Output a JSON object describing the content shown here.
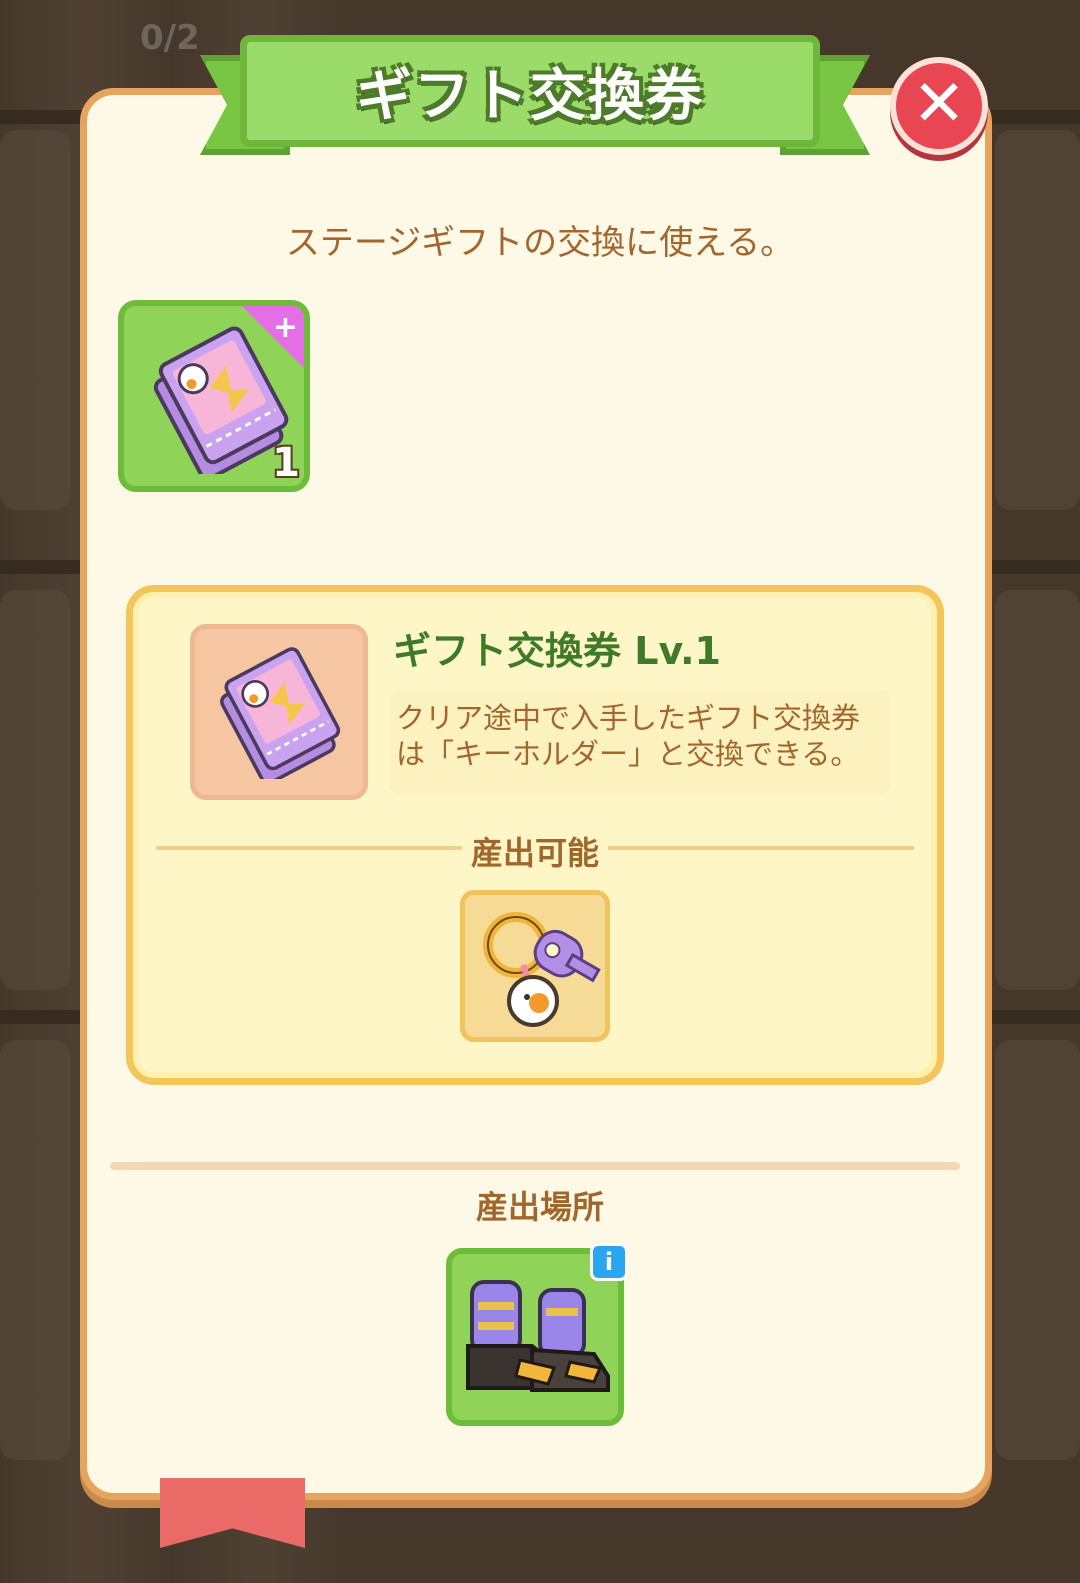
{
  "background": {
    "counter": "0/2"
  },
  "dialog": {
    "title": "ギフト交換券",
    "close_label": "✕",
    "subtitle": "ステージギフトの交換に使える。",
    "owned_item": {
      "icon": "gift-ticket-icon",
      "count": "1",
      "plus": "+"
    },
    "detail": {
      "title": "ギフト交換券 Lv.1",
      "description_line1": "クリア途中で入手したギフト交換券",
      "description_line2": "は「キーホルダー」と交換できる。",
      "output_label": "産出可能",
      "output_icon": "keychain-icon"
    },
    "source": {
      "label": "産出場所",
      "icon": "boots-icon",
      "info_badge": "i"
    }
  },
  "colors": {
    "panel_bg": "#fdf9e6",
    "panel_border": "#e7a45f",
    "title_green": "#9bdb6a",
    "close_red": "#e84652",
    "text_brown": "#a2662e",
    "heading_green": "#3e7a27"
  }
}
